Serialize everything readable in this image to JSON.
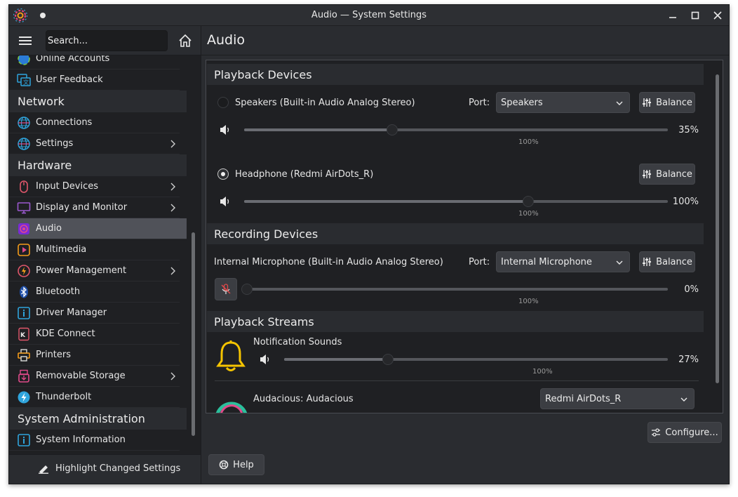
{
  "window": {
    "title": "Audio — System Settings"
  },
  "search": {
    "placeholder": "Search..."
  },
  "page": {
    "title": "Audio"
  },
  "sidebar": {
    "groups": [
      {
        "items": [
          {
            "label": "Online Accounts",
            "icon": "online-accounts-icon"
          },
          {
            "label": "User Feedback",
            "icon": "user-feedback-icon"
          }
        ]
      },
      {
        "category": "Network",
        "items": [
          {
            "label": "Connections",
            "icon": "globe-icon"
          },
          {
            "label": "Settings",
            "icon": "globe-icon",
            "chevron": true
          }
        ]
      },
      {
        "category": "Hardware",
        "items": [
          {
            "label": "Input Devices",
            "icon": "mouse-icon",
            "chevron": true
          },
          {
            "label": "Display and Monitor",
            "icon": "monitor-icon",
            "chevron": true
          },
          {
            "label": "Audio",
            "icon": "audio-icon",
            "active": true
          },
          {
            "label": "Multimedia",
            "icon": "multimedia-icon"
          },
          {
            "label": "Power Management",
            "icon": "power-icon",
            "chevron": true
          },
          {
            "label": "Bluetooth",
            "icon": "bluetooth-icon"
          },
          {
            "label": "Driver Manager",
            "icon": "info-icon"
          },
          {
            "label": "KDE Connect",
            "icon": "kde-connect-icon"
          },
          {
            "label": "Printers",
            "icon": "printer-icon"
          },
          {
            "label": "Removable Storage",
            "icon": "usb-icon",
            "chevron": true
          },
          {
            "label": "Thunderbolt",
            "icon": "thunderbolt-icon"
          }
        ]
      },
      {
        "category": "System Administration",
        "items": [
          {
            "label": "System Information",
            "icon": "info-icon"
          }
        ]
      }
    ],
    "footer_label": "Highlight Changed Settings"
  },
  "playback": {
    "heading": "Playback Devices",
    "devices": [
      {
        "name": "Speakers (Built-in Audio Analog Stereo)",
        "port_label": "Port:",
        "port_value": "Speakers",
        "balance_label": "Balance",
        "volume": "35%",
        "mark": "100%",
        "volume_fraction": 0.35,
        "checked": false
      },
      {
        "name": "Headphone (Redmi AirDots_R)",
        "balance_label": "Balance",
        "volume": "100%",
        "mark": "100%",
        "volume_fraction": 1.0,
        "checked": true
      }
    ]
  },
  "recording": {
    "heading": "Recording Devices",
    "device": {
      "name": "Internal Microphone (Built-in Audio Analog Stereo)",
      "port_label": "Port:",
      "port_value": "Internal Microphone",
      "balance_label": "Balance",
      "volume": "0%",
      "mark": "100%",
      "volume_fraction": 0.0
    }
  },
  "streams": {
    "heading": "Playback Streams",
    "items": [
      {
        "name": "Notification Sounds",
        "volume": "27%",
        "mark": "100%",
        "volume_fraction": 0.27
      },
      {
        "name": "Audacious: Audacious",
        "device": "Redmi AirDots_R"
      }
    ]
  },
  "buttons": {
    "configure": "Configure...",
    "help": "Help"
  },
  "colors": {
    "window_bg": "#2a2c30",
    "sidebar_bg": "#1f2023",
    "active_item": "#505259",
    "bell_yellow": "#f5c400"
  }
}
